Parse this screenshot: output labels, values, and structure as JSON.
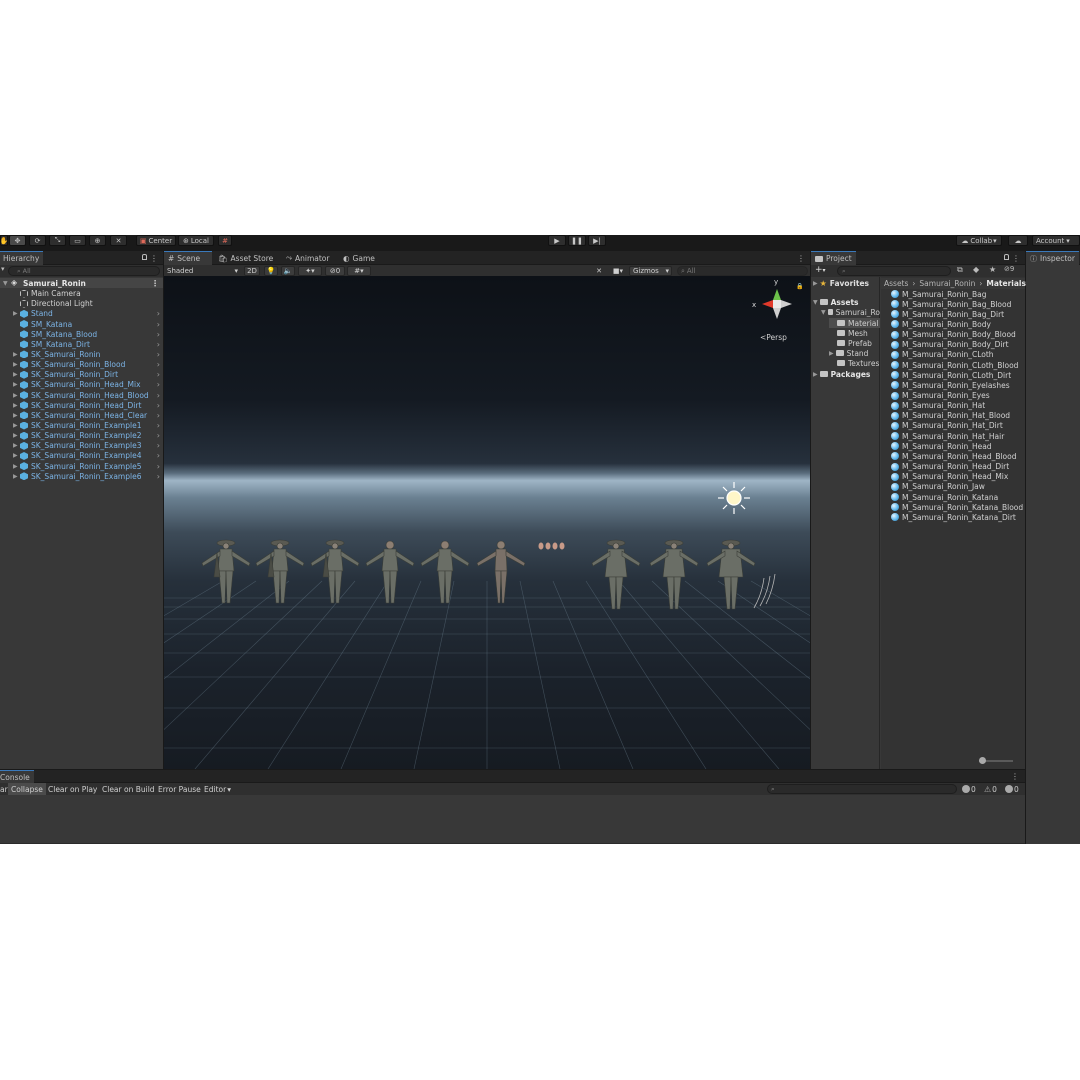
{
  "toolbar": {
    "pivot_mode": "Center",
    "pivot_rotation": "Local",
    "collab": "Collab",
    "account": "Account"
  },
  "hierarchy": {
    "tab": "Hierarchy",
    "search_placeholder": "All",
    "scene": "Samurai_Ronin",
    "items": [
      {
        "label": "Main Camera",
        "icon": "gameobject-icon",
        "style": "white"
      },
      {
        "label": "Directional Light",
        "icon": "gameobject-icon",
        "style": "white"
      },
      {
        "label": "Stand",
        "icon": "prefab-icon",
        "style": "blue"
      },
      {
        "label": "SM_Katana",
        "icon": "prefab-icon",
        "style": "blue"
      },
      {
        "label": "SM_Katana_Blood",
        "icon": "prefab-icon",
        "style": "blue"
      },
      {
        "label": "SM_Katana_Dirt",
        "icon": "prefab-icon",
        "style": "blue"
      },
      {
        "label": "SK_Samurai_Ronin",
        "icon": "prefab-icon",
        "style": "blue"
      },
      {
        "label": "SK_Samurai_Ronin_Blood",
        "icon": "prefab-icon",
        "style": "blue"
      },
      {
        "label": "SK_Samurai_Ronin_Dirt",
        "icon": "prefab-icon",
        "style": "blue"
      },
      {
        "label": "SK_Samurai_Ronin_Head_Mix",
        "icon": "prefab-icon",
        "style": "blue"
      },
      {
        "label": "SK_Samurai_Ronin_Head_Blood",
        "icon": "prefab-icon",
        "style": "blue"
      },
      {
        "label": "SK_Samurai_Ronin_Head_Dirt",
        "icon": "prefab-icon",
        "style": "blue"
      },
      {
        "label": "SK_Samurai_Ronin_Head_Clear",
        "icon": "prefab-icon",
        "style": "blue"
      },
      {
        "label": "SK_Samurai_Ronin_Example1",
        "icon": "prefab-icon",
        "style": "blue"
      },
      {
        "label": "SK_Samurai_Ronin_Example2",
        "icon": "prefab-icon",
        "style": "blue"
      },
      {
        "label": "SK_Samurai_Ronin_Example3",
        "icon": "prefab-icon",
        "style": "blue"
      },
      {
        "label": "SK_Samurai_Ronin_Example4",
        "icon": "prefab-icon",
        "style": "blue"
      },
      {
        "label": "SK_Samurai_Ronin_Example5",
        "icon": "prefab-icon",
        "style": "blue"
      },
      {
        "label": "SK_Samurai_Ronin_Example6",
        "icon": "prefab-icon",
        "style": "blue"
      }
    ]
  },
  "scene_tabs": {
    "scene": "Scene",
    "asset_store": "Asset Store",
    "animator": "Animator",
    "game": "Game"
  },
  "scene_toolbar": {
    "draw_mode": "Shaded",
    "mode_2d": "2D",
    "hidden_count": "0",
    "gizmos": "Gizmos",
    "search_placeholder": "All"
  },
  "gizmo": {
    "x_label": "x",
    "y_label": "y",
    "projection": "Persp"
  },
  "project": {
    "tab": "Project",
    "favorites": "Favorites",
    "tree": [
      {
        "label": "Assets",
        "level": 0,
        "bold": true
      },
      {
        "label": "Samurai_Ro",
        "level": 1,
        "bold": false
      },
      {
        "label": "Material",
        "level": 2,
        "bold": false,
        "selected": true
      },
      {
        "label": "Mesh",
        "level": 2,
        "bold": false
      },
      {
        "label": "Prefab",
        "level": 2,
        "bold": false
      },
      {
        "label": "Stand",
        "level": 2,
        "bold": false
      },
      {
        "label": "Textures",
        "level": 2,
        "bold": false
      },
      {
        "label": "Packages",
        "level": 0,
        "bold": true
      }
    ],
    "breadcrumb": [
      "Assets",
      "Samurai_Ronin",
      "Materials"
    ],
    "hidden_packages": "9",
    "materials": [
      "M_Samurai_Ronin_Bag",
      "M_Samurai_Ronin_Bag_Blood",
      "M_Samurai_Ronin_Bag_Dirt",
      "M_Samurai_Ronin_Body",
      "M_Samurai_Ronin_Body_Blood",
      "M_Samurai_Ronin_Body_Dirt",
      "M_Samurai_Ronin_CLoth",
      "M_Samurai_Ronin_CLoth_Blood",
      "M_Samurai_Ronin_CLoth_Dirt",
      "M_Samurai_Ronin_Eyelashes",
      "M_Samurai_Ronin_Eyes",
      "M_Samurai_Ronin_Hat",
      "M_Samurai_Ronin_Hat_Blood",
      "M_Samurai_Ronin_Hat_Dirt",
      "M_Samurai_Ronin_Hat_Hair",
      "M_Samurai_Ronin_Head",
      "M_Samurai_Ronin_Head_Blood",
      "M_Samurai_Ronin_Head_Dirt",
      "M_Samurai_Ronin_Head_Mix",
      "M_Samurai_Ronin_Jaw",
      "M_Samurai_Ronin_Katana",
      "M_Samurai_Ronin_Katana_Blood",
      "M_Samurai_Ronin_Katana_Dirt"
    ]
  },
  "inspector": {
    "tab": "Inspector"
  },
  "console": {
    "tab": "Console",
    "clear": "ar",
    "collapse": "Collapse",
    "clear_on_play": "Clear on Play",
    "clear_on_build": "Clear on Build",
    "error_pause": "Error Pause",
    "editor": "Editor",
    "log_count": "0",
    "warn_count": "0",
    "error_count": "0"
  }
}
